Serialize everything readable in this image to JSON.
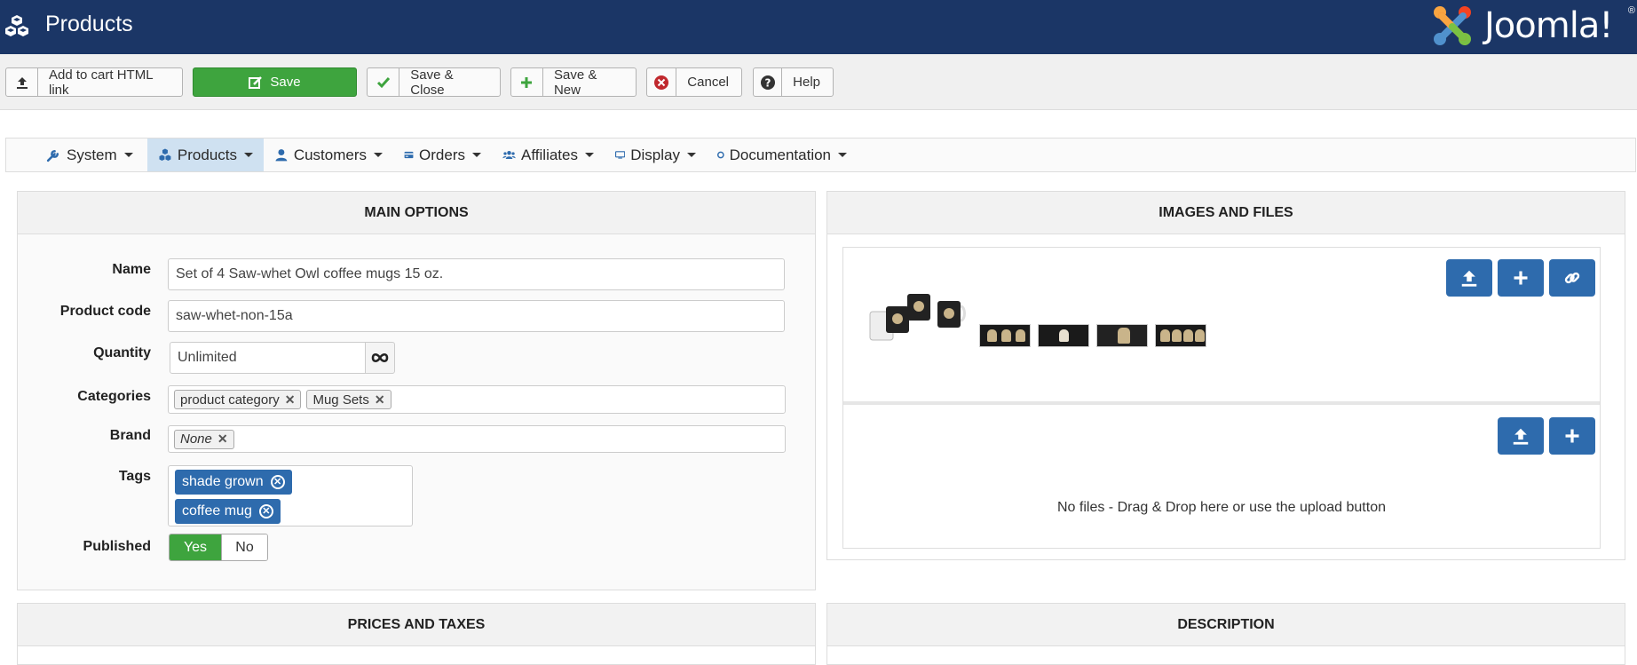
{
  "header": {
    "title": "Products",
    "logo_text": "Joomla!",
    "reg_mark": "®"
  },
  "toolbar": {
    "add_to_cart": "Add to cart HTML link",
    "save": "Save",
    "save_close": "Save & Close",
    "save_new": "Save & New",
    "cancel": "Cancel",
    "help": "Help"
  },
  "nav": {
    "system": "System",
    "products": "Products",
    "customers": "Customers",
    "orders": "Orders",
    "affiliates": "Affiliates",
    "display": "Display",
    "documentation": "Documentation"
  },
  "main_options": {
    "heading": "MAIN OPTIONS",
    "name_label": "Name",
    "name_value": "Set of 4 Saw-whet Owl coffee mugs 15 oz.",
    "code_label": "Product code",
    "code_value": "saw-whet-non-15a",
    "quantity_label": "Quantity",
    "quantity_value": "Unlimited",
    "categories_label": "Categories",
    "categories": [
      "product category",
      "Mug Sets"
    ],
    "brand_label": "Brand",
    "brand_value": "None",
    "tags_label": "Tags",
    "tags": [
      "shade grown",
      "coffee mug"
    ],
    "published_label": "Published",
    "published_yes": "Yes",
    "published_no": "No"
  },
  "images_files": {
    "heading": "IMAGES AND FILES",
    "no_files": "No files - Drag & Drop here or use the upload button"
  },
  "prices": {
    "heading": "PRICES AND TAXES"
  },
  "description": {
    "heading": "DESCRIPTION"
  },
  "colors": {
    "header_bg": "#1b3666",
    "accent_blue": "#2e6bad",
    "save_green": "#3ea43e"
  }
}
